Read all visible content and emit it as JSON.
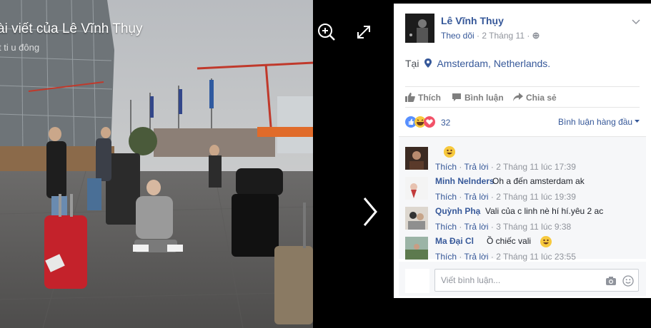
{
  "viewer": {
    "post_title": "ài viết của Lê Vĩnh Thụy",
    "post_sub": "t ti u đông"
  },
  "post": {
    "author": "Lê Vĩnh Thụy",
    "follow": "Theo dõi",
    "date": "2 Tháng 11",
    "dot": "·",
    "location_prefix": "Tại",
    "location": "Amsterdam, Netherlands."
  },
  "actions": {
    "like": "Thích",
    "comment": "Bình luận",
    "share": "Chia sẻ"
  },
  "reactions": {
    "count": "32",
    "sort_label": "Bình luận hàng đầu"
  },
  "comments": [
    {
      "name": "",
      "text": "",
      "like": "Thích",
      "reply": "Trả lời",
      "time": "2 Tháng 11 lúc 17:39"
    },
    {
      "name": "Minh Nelnders",
      "text": "Oh a đến amsterdam ak",
      "like": "Thích",
      "reply": "Trả lời",
      "time": "2 Tháng 11 lúc 19:39"
    },
    {
      "name": "Quỳnh Phạ",
      "text": "Vali của c linh nè hí hí.yêu 2 ac",
      "like": "Thích",
      "reply": "Trả lời",
      "time": "3 Tháng 11 lúc 9:38"
    },
    {
      "name": "Ma Đại Cl",
      "text": "Ồ chiếc vali",
      "like": "Thích",
      "reply": "Trả lời",
      "time": "2 Tháng 11 lúc 23:55"
    }
  ],
  "composer": {
    "placeholder": "Viết bình luận..."
  },
  "colors": {
    "link": "#365899",
    "muted": "#90949c",
    "like_blue": "#5890ff",
    "love_red": "#f25268"
  }
}
